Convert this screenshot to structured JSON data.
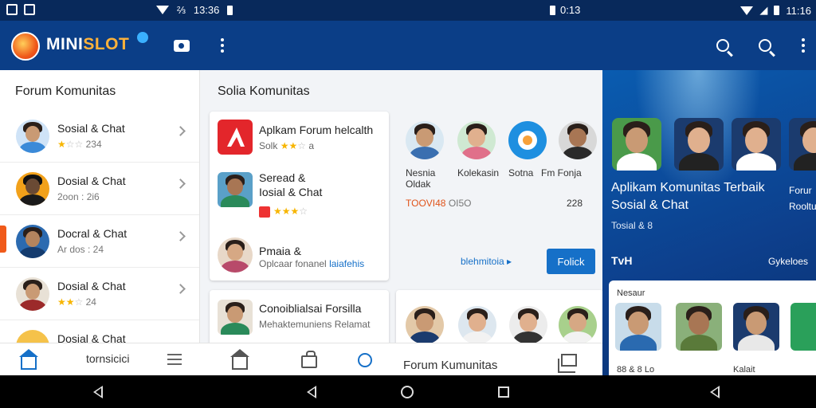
{
  "status_bar": {
    "time_left": "13:36",
    "time_mid": "0:13",
    "time_right": "11:16"
  },
  "app": {
    "brand_prefix": "MINI",
    "brand_suffix": "SLOT",
    "accent": "#0b3e87",
    "brand_orange": "#ffb23a"
  },
  "left_panel": {
    "title": "Forum Komunitas",
    "items": [
      {
        "title": "Sosial & Chat",
        "meta": "234",
        "stars": 1,
        "avatar_color": "#3b8ad8"
      },
      {
        "title": "Dosial & Chat",
        "meta": "2oon : 2i6",
        "stars": 0,
        "avatar_color": "#f2a11a"
      },
      {
        "title": "Docral & Chat",
        "meta": "Ar dos : 24",
        "stars": 0,
        "avatar_color": "#2b6ab0"
      },
      {
        "title": "Dosial & Chat",
        "meta": "24",
        "stars": 2,
        "avatar_color": "#9c2a2a"
      },
      {
        "title": "Dosial & Chat",
        "meta": "",
        "stars": 0,
        "avatar_color": "#f5c24a"
      }
    ]
  },
  "mid_panel": {
    "title": "Solia Komunitas",
    "card1": {
      "app_title": "Aplkam Forum helcalth",
      "app_sub": "Solk",
      "app_sub_num": "a",
      "item2_title": "Seread &",
      "item2_sub": "Iosial & Chat",
      "item3_title": "Pmaia &",
      "item3_sub": "Oplcaar fonanel",
      "item3_link": "laiafehis"
    },
    "people": [
      {
        "label": "Nesnia",
        "color": "#3a6fb0"
      },
      {
        "label": "Kolekasin",
        "color": "#e0708a"
      },
      {
        "label": "Sotna",
        "color": "#f7a13a"
      },
      {
        "label": "Fm Fonja",
        "color": "#2a2a2a"
      }
    ],
    "people_sub": "Oldak",
    "stat_left": "TOOVI48",
    "stat_left_2": "OI5O",
    "stat_right": "228",
    "link_text": "blehmitoia",
    "follow_button": "Folick",
    "card2": {
      "title": "Conoiblialsai Forsilla",
      "sub": "Mehaktemuniens Relamat"
    }
  },
  "right_panel": {
    "title_line1": "Aplikam Komunitas Terbaik",
    "title_line2": "Sosial & Chat",
    "sub": "Tosial & 8",
    "brand": "TvH",
    "link": "Gykeloes",
    "side_text_1": "Forur",
    "side_text_2": "Rooltu",
    "panel_header": "Nesaur",
    "tile_caption_1": "88 & 8 Lo",
    "tile_caption_2": "Kalait"
  },
  "bottom_nav": {
    "label": "tornsicici",
    "label2": "Forum Kumunitas"
  }
}
